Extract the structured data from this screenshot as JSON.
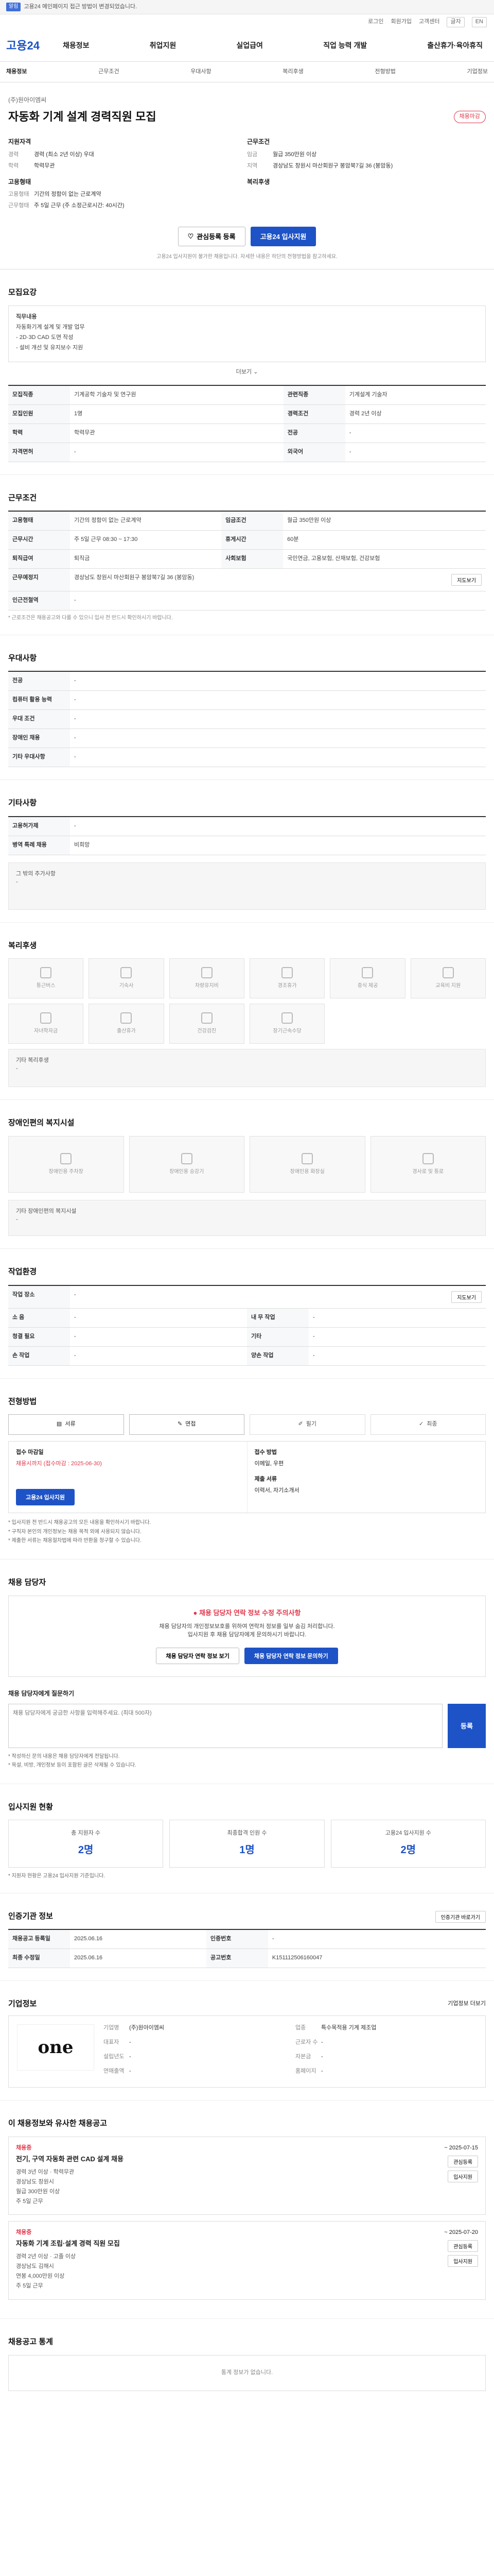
{
  "topbar": {
    "badge": "알림",
    "text": "고용24 메인페이지 접근 방법이 변경되었습니다."
  },
  "util": {
    "items": [
      "로그인",
      "회원가입",
      "고객센터"
    ],
    "font": "글자",
    "en": "EN"
  },
  "header": {
    "logo": "고용24",
    "gnb": [
      "채용정보",
      "취업지원",
      "실업급여",
      "직업 능력 개발",
      "출산휴가·육아휴직"
    ]
  },
  "subnav": [
    "채용정보",
    "근무조건",
    "우대사항",
    "복리후생",
    "전형방법",
    "기업정보"
  ],
  "title": {
    "company": "(주)원아이엠씨",
    "job_title": "자동화 기계 설계 경력직원 모집",
    "badge": "채용마감",
    "qual_head": "지원자격",
    "cond_head": "근무조건",
    "qual": [
      {
        "k": "경력",
        "v": "경력 (최소 2년 이상) 우대"
      },
      {
        "k": "학력",
        "v": "학력무관"
      }
    ],
    "cond": [
      {
        "k": "임금",
        "v": "월급 350만원 이상"
      },
      {
        "k": "지역",
        "v": "경상남도 창원시 마산회원구 봉암북7길 36 (봉암동)"
      }
    ],
    "type_head": "고용형태",
    "type": [
      {
        "k": "고용형태",
        "v": "기간의 정함이 없는 근로계약"
      },
      {
        "k": "근무형태",
        "v": "주 5일 근무 (주 소정근로시간: 40시간)"
      }
    ],
    "welfare_head": "복리후생",
    "btn_interest": "관심등록 등록",
    "btn_apply": "고용24 입사지원",
    "notice": "고용24 입사지원이 불가한 채용입니다. 자세한 내용은 하단의 전형방법을 참고하세요."
  },
  "main_section": {
    "title": "모집요강",
    "duty_head": "직무내용",
    "duty": [
      "자동화기계 설계 및 개발 업무",
      "- 2D·3D CAD 도면 작성",
      "- 설비 개선 및 유지보수 지원"
    ],
    "more": "더보기",
    "rows": [
      {
        "k": "모집직종",
        "v": "기계공학 기술자 및 연구원",
        "k2": "관련직종",
        "v2": "기계설계 기술자"
      },
      {
        "k": "모집인원",
        "v": "1명",
        "k2": "경력조건",
        "v2": "경력 2년 이상"
      },
      {
        "k": "학력",
        "v": "학력무관",
        "k2": "전공",
        "v2": "-"
      },
      {
        "k": "자격면허",
        "v": "-",
        "k2": "외국어",
        "v2": "-"
      }
    ]
  },
  "work_section": {
    "title": "근무조건",
    "rows": [
      {
        "k": "고용형태",
        "v": "기간의 정함이 없는 근로계약",
        "k2": "임금조건",
        "v2": "월급 350만원 이상"
      },
      {
        "k": "근무시간",
        "v": "주 5일 근무 08:30 ~ 17:30",
        "k2": "휴게시간",
        "v2": "60분"
      },
      {
        "k": "퇴직급여",
        "v": "퇴직금",
        "k2": "사회보험",
        "v2": "국민연금, 고용보험, 산재보험, 건강보험"
      },
      {
        "k": "근무예정지",
        "v": "경상남도 창원시 마산회원구 봉암북7길 36 (봉암동)",
        "k2": "",
        "v2": ""
      },
      {
        "k": "인근전철역",
        "v": "-",
        "k2": "",
        "v2": ""
      }
    ],
    "map_btn": "지도보기",
    "note": "* 근로조건은 채용공고와 다를 수 있으니 입사 전 반드시 확인하시기 바랍니다."
  },
  "pref_section": {
    "title": "우대사항",
    "rows": [
      {
        "k": "전공",
        "v": "-"
      },
      {
        "k": "컴퓨터 활용 능력",
        "v": "-"
      },
      {
        "k": "우대 조건",
        "v": "-"
      },
      {
        "k": "장애인 채용",
        "v": "-"
      },
      {
        "k": "기타 우대사항",
        "v": "-"
      }
    ]
  },
  "etc_section": {
    "title": "기타사항",
    "rows": [
      {
        "k": "고용허가제",
        "v": "-"
      },
      {
        "k": "병역 특례 채용",
        "v": "비희망"
      }
    ],
    "extra": "그 밖의 추가사항",
    "extra_val": "-"
  },
  "welfare_section": {
    "title": "복리후생",
    "icons": [
      "통근버스",
      "기숙사",
      "차량유지비",
      "경조휴가",
      "중식 제공",
      "교육비 지원",
      "자녀학자금",
      "출산휴가",
      "건강검진",
      "장기근속수당"
    ],
    "extra_head": "기타 복리후생",
    "extra_val": "-"
  },
  "disabled_section": {
    "title": "장애인편의 복지시설",
    "icons": [
      "장애인용 주차장",
      "장애인용 승강기",
      "장애인용 화장실",
      "경사로 및 통로"
    ],
    "extra_head": "기타 장애인편의 복지시설",
    "extra_val": "-"
  },
  "env_section": {
    "title": "작업환경",
    "rows": [
      {
        "k": "작업 장소",
        "v": "-",
        "k2": "",
        "v2": ""
      },
      {
        "k": "소 음",
        "v": "-",
        "k2": "내 무 작업",
        "v2": "-"
      },
      {
        "k": "청결 필요",
        "v": "-",
        "k2": "기타",
        "v2": "-"
      },
      {
        "k": "손 작업",
        "v": "-",
        "k2": "양손 작업",
        "v2": "-"
      }
    ],
    "map_btn": "지도보기"
  },
  "process_section": {
    "title": "전형방법",
    "steps": [
      "서류",
      "면접",
      "필기",
      "최종"
    ],
    "apply_head": "접수 마감일",
    "apply_val": "채용시까지 (접수마감 : 2025-06-30)",
    "method_head": "접수 방법",
    "method_val": "이메일, 우편",
    "doc_head": "제출 서류",
    "doc_val": "이력서, 자기소개서",
    "btn": "고용24 입사지원",
    "bullets": [
      "* 입사지원 전 반드시 채용공고의 모든 내용을 확인하시기 바랍니다.",
      "* 구직자 본인의 개인정보는 채용 목적 외에 사용되지 않습니다.",
      "* 제출한 서류는 채용절차법에 따라 반환을 청구할 수 있습니다."
    ]
  },
  "contact_section": {
    "title": "채용 담당자",
    "warn_title": "채용 담당자 연락 정보 수정 주의사항",
    "warn_lines": [
      "채용 담당자의 개인정보보호를 위하여 연락처 정보를 일부 숨김 처리합니다.",
      "입사지원 후 채용 담당자에게 문의하시기 바랍니다."
    ],
    "btn1": "채용 담당자 연락 정보 보기",
    "btn2": "채용 담당자 연락 정보 문의하기",
    "inq_head": "채용 담당자에게 질문하기",
    "inq_placeholder": "채용 담당자에게 궁금한 사항을 입력해주세요. (최대 500자)",
    "send": "등록",
    "bullets": [
      "* 작성하신 문의 내용은 채용 담당자에게 전달됩니다.",
      "* 욕설, 비방, 개인정보 등이 포함된 글은 삭제될 수 있습니다."
    ]
  },
  "status_section": {
    "title": "입사지원 현황",
    "cards": [
      {
        "lbl": "총 지원자 수",
        "num": "2명"
      },
      {
        "lbl": "최종합격 인원 수",
        "num": "1명"
      },
      {
        "lbl": "고용24 입사지원 수",
        "num": "2명"
      }
    ],
    "note": "* 지원자 현황은 고용24 입사지원 기준입니다."
  },
  "info_section": {
    "title": "인증기관 정보",
    "btn": "인증기관 바로가기",
    "rows": [
      {
        "k": "채용공고 등록일",
        "v": "2025.06.16",
        "k2": "인증번호",
        "v2": "-"
      },
      {
        "k": "최종 수정일",
        "v": "2025.06.16",
        "k2": "공고번호",
        "v2": "K151112506160047"
      }
    ]
  },
  "company_section": {
    "title": "기업정보",
    "more": "기업정보 더보기",
    "logo": "one",
    "info": [
      {
        "k": "기업명",
        "v": "(주)원아이엠씨"
      },
      {
        "k": "업종",
        "v": "특수목적용 기계 제조업"
      },
      {
        "k": "대표자",
        "v": "-"
      },
      {
        "k": "근로자 수",
        "v": "-"
      },
      {
        "k": "설립년도",
        "v": "-"
      },
      {
        "k": "자본금",
        "v": "-"
      },
      {
        "k": "연매출액",
        "v": "-"
      },
      {
        "k": "홈페이지",
        "v": "-"
      }
    ]
  },
  "rec_section": {
    "title": "이 채용정보와 유사한 채용공고",
    "items": [
      {
        "tag": "채용중",
        "title": "전기, 구역 자동화 관련 CAD 설계 채용",
        "meta1": "경력 3년 이상 · 학력무관",
        "meta2": "경상남도 창원시",
        "meta3": "월급 300만원 이상",
        "meta4": "주 5일 근무",
        "date": "~ 2025-07-15",
        "btn1": "관심등록",
        "btn2": "입사지원"
      },
      {
        "tag": "채용중",
        "title": "자동화 기계 조립·설계 경력 직원 모집",
        "meta1": "경력 2년 이상 · 고졸 이상",
        "meta2": "경상남도 김해시",
        "meta3": "연봉 4,000만원 이상",
        "meta4": "주 5일 근무",
        "date": "~ 2025-07-20",
        "btn1": "관심등록",
        "btn2": "입사지원"
      }
    ]
  },
  "stat_section": {
    "title": "채용공고 통계",
    "text": "통계 정보가 없습니다."
  }
}
